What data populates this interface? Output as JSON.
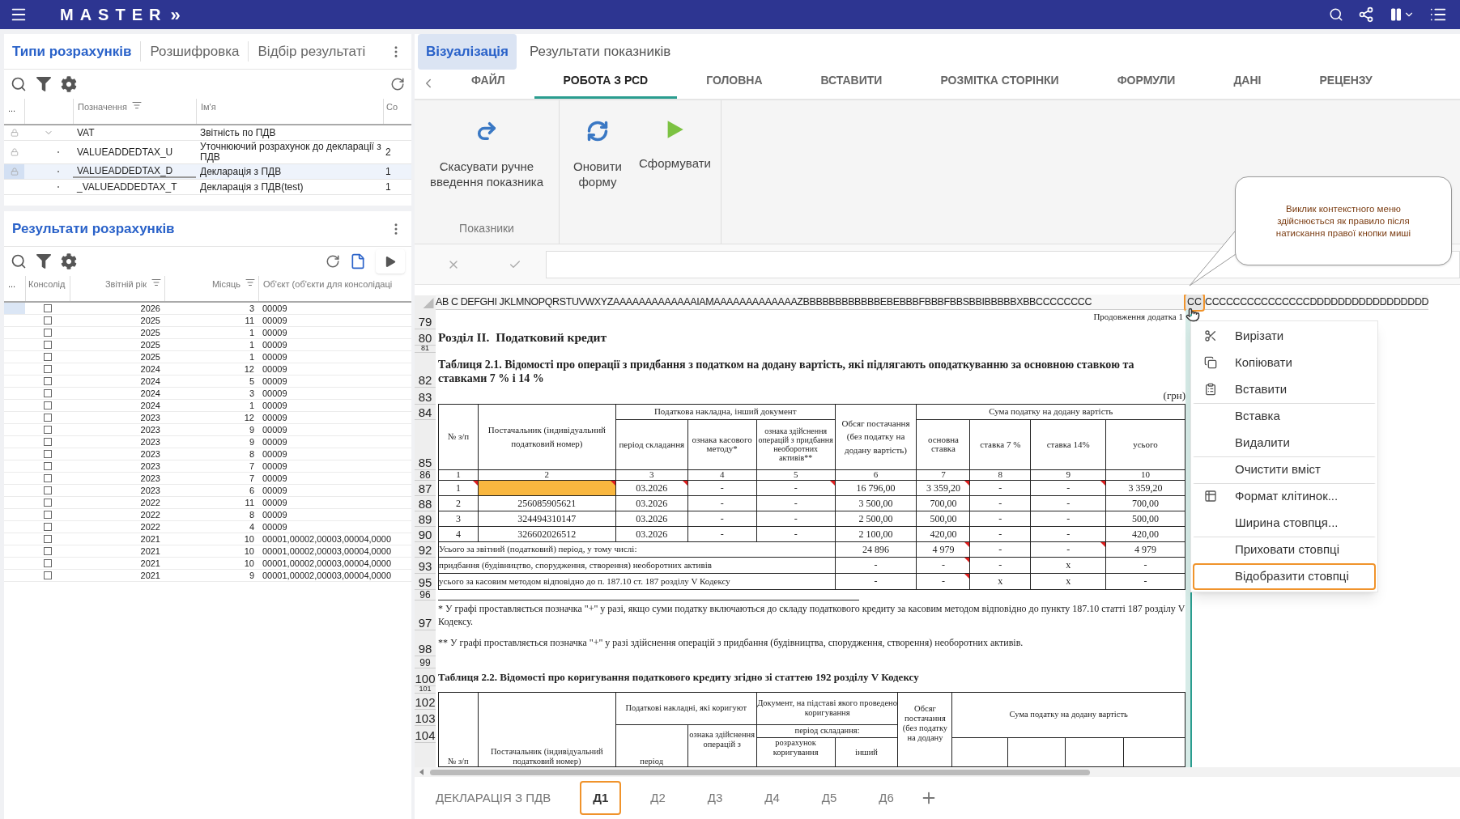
{
  "app_bar": {
    "title": "MASTER",
    "expand_label": "»"
  },
  "left_tabs": [
    {
      "label": "Типи розрахунків",
      "selected": true
    },
    {
      "label": "Розшифровка",
      "selected": false
    },
    {
      "label": "Відбір результаті",
      "selected": false
    }
  ],
  "calc_types": {
    "columns": [
      "...",
      "Позначення",
      "Ім'я",
      "Со"
    ],
    "rows": [
      {
        "code": "VAT",
        "name": "Звітність по ПДВ",
        "locked": true,
        "expanded": true,
        "selected": false,
        "children": [
          {
            "code": "VALUEADDEDTAX_U",
            "name": "Уточнюючий розрахунок до декларації з ПДВ",
            "column_5": "2",
            "locked": true,
            "selected": false
          },
          {
            "code": "VALUEADDEDTAX_D",
            "name": "Декларація з ПДВ",
            "column_5": "1",
            "locked": true,
            "selected": true
          },
          {
            "code": "_VALUEADDEDTAX_T",
            "name": "Декларація з ПДВ(test)",
            "column_5": "1",
            "locked": false,
            "selected": false
          }
        ]
      }
    ]
  },
  "results": {
    "title": "Результати розрахунків",
    "columns": [
      "...",
      "Консолід",
      "Звітній рік",
      "Місяць",
      "Об'єкт (об'єкти для консолідаці"
    ],
    "rows": [
      {
        "checked": false,
        "year": "2026",
        "month": "3",
        "object": "00009",
        "selected": true
      },
      {
        "checked": false,
        "year": "2025",
        "month": "11",
        "object": "00009",
        "selected": false
      },
      {
        "checked": false,
        "year": "2025",
        "month": "1",
        "object": "00009",
        "selected": false
      },
      {
        "checked": false,
        "year": "2025",
        "month": "1",
        "object": "00009",
        "selected": false
      },
      {
        "checked": false,
        "year": "2025",
        "month": "1",
        "object": "00009",
        "selected": false
      },
      {
        "checked": false,
        "year": "2024",
        "month": "12",
        "object": "00009",
        "selected": false
      },
      {
        "checked": false,
        "year": "2024",
        "month": "5",
        "object": "00009",
        "selected": false
      },
      {
        "checked": false,
        "year": "2024",
        "month": "3",
        "object": "00009",
        "selected": false
      },
      {
        "checked": false,
        "year": "2024",
        "month": "1",
        "object": "00009",
        "selected": false
      },
      {
        "checked": false,
        "year": "2023",
        "month": "12",
        "object": "00009",
        "selected": false
      },
      {
        "checked": false,
        "year": "2023",
        "month": "9",
        "object": "00009",
        "selected": false
      },
      {
        "checked": false,
        "year": "2023",
        "month": "9",
        "object": "00009",
        "selected": false
      },
      {
        "checked": false,
        "year": "2023",
        "month": "8",
        "object": "00009",
        "selected": false
      },
      {
        "checked": false,
        "year": "2023",
        "month": "7",
        "object": "00009",
        "selected": false
      },
      {
        "checked": false,
        "year": "2023",
        "month": "7",
        "object": "00009",
        "selected": false
      },
      {
        "checked": false,
        "year": "2023",
        "month": "6",
        "object": "00009",
        "selected": false
      },
      {
        "checked": false,
        "year": "2022",
        "month": "11",
        "object": "00009",
        "selected": false
      },
      {
        "checked": false,
        "year": "2022",
        "month": "8",
        "object": "00009",
        "selected": false
      },
      {
        "checked": false,
        "year": "2022",
        "month": "4",
        "object": "00009",
        "selected": false
      },
      {
        "checked": false,
        "year": "2021",
        "month": "10",
        "object": "00001,00002,00003,00004,0000",
        "selected": false
      },
      {
        "checked": false,
        "year": "2021",
        "month": "10",
        "object": "00001,00002,00003,00004,0000",
        "selected": false
      },
      {
        "checked": false,
        "year": "2021",
        "month": "10",
        "object": "00001,00002,00003,00004,0000",
        "selected": false
      },
      {
        "checked": false,
        "year": "2021",
        "month": "9",
        "object": "00001,00002,00003,00004,0000",
        "selected": false
      }
    ]
  },
  "right_tabs": [
    {
      "label": "Візуалізація",
      "selected": true
    },
    {
      "label": "Результати показників",
      "selected": false
    }
  ],
  "ribbon": {
    "tabs": [
      {
        "label": "ФАЙЛ",
        "selected": false
      },
      {
        "label": "РОБОТА З РСD",
        "selected": true
      },
      {
        "label": "ГОЛОВНА",
        "selected": false
      },
      {
        "label": "ВСТАВИТИ",
        "selected": false
      },
      {
        "label": "РОЗМІТКА СТОРІНКИ",
        "selected": false
      },
      {
        "label": "ФОРМУЛИ",
        "selected": false
      },
      {
        "label": "ДАНІ",
        "selected": false
      },
      {
        "label": "РЕЦЕНЗУ",
        "selected": false
      }
    ],
    "groups": [
      {
        "label": "Показники",
        "buttons": [
          {
            "label": "Скасувати ручне введення показника",
            "kind": "undo"
          }
        ]
      },
      {
        "buttons": [
          {
            "label": "Оновити форму",
            "kind": "refresh"
          },
          {
            "label": "Сформувати",
            "kind": "run"
          }
        ]
      }
    ]
  },
  "callout": "Виклик контекстного меню здійснюється як правило після натискання правої кнопки миші",
  "sheet": {
    "column_letters": {
      "before": "AB C DEFGHI JKLMNOPQRSTUVWXYZAAAAAAAAAAAAAIAMAAAAAAAAAAAAAZBBBBBBBBBBBBEBEBBBFBBBFBBSBBIBBBBBXBBCCCCCCCC",
      "selected": "CC",
      "after": "CCCCCCCCCCCCCCCDDDDDDDDDDDDDDDDD"
    },
    "row_numbers": [
      "79",
      "80",
      "81",
      "82",
      "83",
      "84",
      "85",
      "86",
      "87",
      "88",
      "89",
      "90",
      "92",
      "93",
      "95",
      "96",
      "97",
      "98",
      "99",
      "100",
      "101",
      "102",
      "103",
      "104"
    ],
    "page_note": "Продовження додатка 1",
    "section_title": "Розділ II.  Податковий кредит",
    "table_1_title": "Таблиця 2.1. Відомості про операції з придбання з податком на додану вартість, які підлягають оподаткуванню за основною ставкою та ставками 7 % і 14 %",
    "currency_note": "(грн)",
    "table_1": {
      "group_headers": [
        "Податкова накладна, інший документ",
        "Сума податку на додану вартість"
      ],
      "headers": [
        "№ з/п",
        "Постачальник (індивідуальний податковий номер)",
        "період складання",
        "ознака касового методу*",
        "ознака здійснення операцій з придбання необоротних активів**",
        "Обсяг постачання (без податку на додану вартість)",
        "основна ставка",
        "ставка 7 %",
        "ставка 14%",
        "усього"
      ],
      "column_numbers": [
        "1",
        "2",
        "3",
        "4",
        "5",
        "6",
        "7",
        "8",
        "9",
        "10"
      ],
      "rows": [
        {
          "cells": [
            {
              "text": "1",
              "flagged": true,
              "active": false
            },
            {
              "flagged": true,
              "active": true
            },
            {
              "text": "03.2026",
              "flagged": true,
              "active": false
            },
            {
              "text": "-",
              "flagged": false,
              "active": false
            },
            {
              "text": "-",
              "flagged": true,
              "active": false
            },
            {
              "text": "16 796,00",
              "flagged": false,
              "active": false
            },
            {
              "text": "3 359,20",
              "flagged": true,
              "active": false
            },
            {
              "text": "-",
              "flagged": false,
              "active": false
            },
            {
              "text": "-",
              "flagged": true,
              "active": false
            },
            {
              "text": "3 359,20",
              "flagged": false,
              "active": false
            }
          ]
        },
        {
          "cells": [
            {
              "text": "2",
              "flagged": false,
              "active": false
            },
            {
              "text": "256085905621",
              "flagged": false,
              "active": false
            },
            {
              "text": "03.2026",
              "flagged": false,
              "active": false
            },
            {
              "text": "-",
              "flagged": false,
              "active": false
            },
            {
              "text": "-",
              "flagged": false,
              "active": false
            },
            {
              "text": "3 500,00",
              "flagged": false,
              "active": false
            },
            {
              "text": "700,00",
              "flagged": false,
              "active": false
            },
            {
              "text": "-",
              "flagged": false,
              "active": false
            },
            {
              "text": "-",
              "flagged": false,
              "active": false
            },
            {
              "text": "700,00",
              "flagged": false,
              "active": false
            }
          ]
        },
        {
          "cells": [
            {
              "text": "3",
              "flagged": false,
              "active": false
            },
            {
              "text": "324494310147",
              "flagged": false,
              "active": false
            },
            {
              "text": "03.2026",
              "flagged": false,
              "active": false
            },
            {
              "text": "-",
              "flagged": false,
              "active": false
            },
            {
              "text": "-",
              "flagged": false,
              "active": false
            },
            {
              "text": "2 500,00",
              "flagged": false,
              "active": false
            },
            {
              "text": "500,00",
              "flagged": false,
              "active": false
            },
            {
              "text": "-",
              "flagged": false,
              "active": false
            },
            {
              "text": "-",
              "flagged": false,
              "active": false
            },
            {
              "text": "500,00",
              "flagged": false,
              "active": false
            }
          ]
        },
        {
          "cells": [
            {
              "text": "4",
              "flagged": false,
              "active": false
            },
            {
              "text": "326602026512",
              "flagged": false,
              "active": false
            },
            {
              "text": "03.2026",
              "flagged": false,
              "active": false
            },
            {
              "text": "-",
              "flagged": false,
              "active": false
            },
            {
              "text": "-",
              "flagged": false,
              "active": false
            },
            {
              "text": "2 100,00",
              "flagged": false,
              "active": false
            },
            {
              "text": "420,00",
              "flagged": false,
              "active": false
            },
            {
              "text": "-",
              "flagged": false,
              "active": false
            },
            {
              "text": "-",
              "flagged": false,
              "active": false
            },
            {
              "text": "420,00",
              "flagged": false,
              "active": false
            }
          ]
        }
      ],
      "totals": [
        {
          "label": "Усього за звітний (податковий) період, у тому числі:",
          "values": [
            {
              "text": "24 896",
              "flagged": false
            },
            {
              "text": "4 979",
              "flagged": true
            },
            {
              "text": "-",
              "flagged": false
            },
            {
              "text": "-",
              "flagged": true
            },
            {
              "text": "4 979",
              "flagged": false
            }
          ]
        },
        {
          "label": "придбання (будівництво, спорудження, створення) необоротних активів",
          "values": [
            {
              "text": "-",
              "flagged": false
            },
            {
              "text": "-",
              "flagged": true
            },
            {
              "text": "-",
              "flagged": false
            },
            {
              "text": "x",
              "flagged": false
            },
            {
              "text": "-",
              "flagged": false
            }
          ]
        },
        {
          "label": "усього за касовим методом відповідно до п. 187.10 ст. 187 розділу V Кодексу",
          "values": [
            {
              "text": "-",
              "flagged": false
            },
            {
              "text": "-",
              "flagged": true
            },
            {
              "text": "x",
              "flagged": false
            },
            {
              "text": "x",
              "flagged": false
            },
            {
              "text": "-",
              "flagged": false
            }
          ]
        }
      ]
    },
    "footnotes": [
      "* У графі проставляється позначка \"+\" у разі, якщо суми податку включаються до складу податкового кредиту за касовим методом відповідно до пункту 187.10 статті 187 розділу V Кодексу.",
      "** У графі проставляється позначка \"+\" у разі здійснення операцій з придбання (будівництва, спорудження, створення) необоротних активів."
    ],
    "table_2_title": "Таблиця 2.2. Відомості про коригування податкового кредиту згідно зі статтею 192 розділу V Кодексу",
    "table_2": {
      "headers": [
        "№ з/п",
        "Постачальник (індивідуальний податковий номер)",
        "Податкові накладні, які коригуют",
        "Документ, на підставі якого проведено коригування",
        "Обсяг постачання (без податку на додану",
        "Сума податку на додану вартість"
      ],
      "subheaders": [
        "період",
        "ознака здійснення операцій з",
        "період складання:",
        "розрахунок коригування",
        "інший"
      ]
    }
  },
  "context_menu": [
    {
      "label": "Вирізати",
      "kind": "cut",
      "separator_before": false,
      "selected": false
    },
    {
      "label": "Копіювати",
      "kind": "copy",
      "separator_before": false,
      "selected": false
    },
    {
      "label": "Вставити",
      "kind": "paste",
      "separator_before": false,
      "selected": false
    },
    {
      "label": "Вставка",
      "kind": "text",
      "separator_before": true,
      "selected": false
    },
    {
      "label": "Видалити",
      "kind": "text",
      "separator_before": false,
      "selected": false
    },
    {
      "label": "Очистити вміст",
      "kind": "text",
      "separator_before": true,
      "selected": false
    },
    {
      "label": "Формат клітинок...",
      "kind": "format",
      "separator_before": true,
      "selected": false
    },
    {
      "label": "Ширина стовпця...",
      "kind": "text",
      "separator_before": false,
      "selected": false
    },
    {
      "label": "Приховати стовпці",
      "kind": "text",
      "separator_before": true,
      "selected": false
    },
    {
      "label": "Відобразити стовпці",
      "kind": "text",
      "separator_before": false,
      "selected": true
    }
  ],
  "sheet_tabs": [
    {
      "label": "ДЕКЛАРАЦІЯ З ПДВ",
      "selected": false
    },
    {
      "label": "Д1",
      "selected": true
    },
    {
      "label": "Д2",
      "selected": false
    },
    {
      "label": "Д3",
      "selected": false
    },
    {
      "label": "Д4",
      "selected": false
    },
    {
      "label": "Д5",
      "selected": false
    },
    {
      "label": "Д6",
      "selected": false
    }
  ]
}
